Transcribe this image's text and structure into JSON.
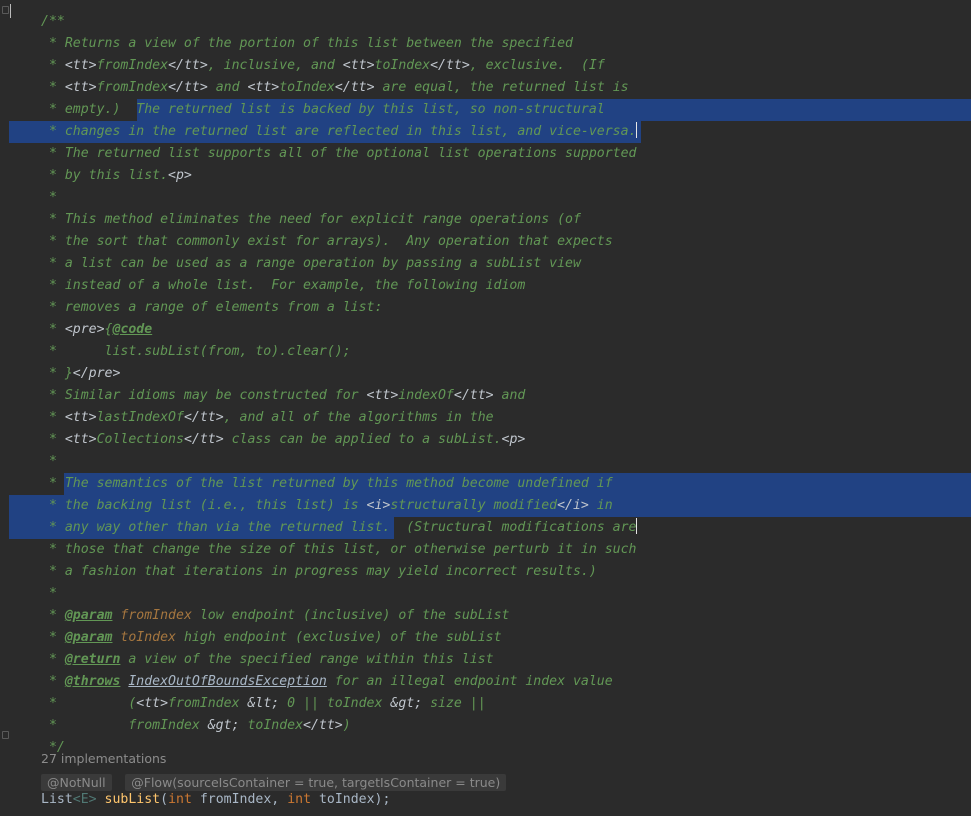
{
  "editor": {
    "doc_lines": [
      "/**",
      " * Returns a view of the portion of this list between the specified",
      " * <tt>fromIndex</tt>, inclusive, and <tt>toIndex</tt>, exclusive.  (If",
      " * <tt>fromIndex</tt> and <tt>toIndex</tt> are equal, the returned list is",
      " * empty.)  The returned list is backed by this list, so non-structural",
      " * changes in the returned list are reflected in this list, and vice-versa.",
      " * The returned list supports all of the optional list operations supported",
      " * by this list.<p>",
      " *",
      " * This method eliminates the need for explicit range operations (of",
      " * the sort that commonly exist for arrays).  Any operation that expects",
      " * a list can be used as a range operation by passing a subList view",
      " * instead of a whole list.  For example, the following idiom",
      " * removes a range of elements from a list:",
      " * <pre>{@code",
      " *      list.subList(from, to).clear();",
      " * }</pre>",
      " * Similar idioms may be constructed for <tt>indexOf</tt> and",
      " * <tt>lastIndexOf</tt>, and all of the algorithms in the",
      " * <tt>Collections</tt> class can be applied to a subList.<p>",
      " *",
      " * The semantics of the list returned by this method become undefined if",
      " * the backing list (i.e., this list) is <i>structurally modified</i> in",
      " * any way other than via the returned list.  (Structural modifications are",
      " * those that change the size of this list, or otherwise perturb it in such",
      " * a fashion that iterations in progress may yield incorrect results.)",
      " *",
      " * @param fromIndex low endpoint (inclusive) of the subList",
      " * @param toIndex high endpoint (exclusive) of the subList",
      " * @return a view of the specified range within this list",
      " * @throws IndexOutOfBoundsException for an illegal endpoint index value",
      " *         (<tt>fromIndex &lt; 0 || toIndex &gt; size ||",
      " *         fromIndex &gt; toIndex</tt>)",
      " */"
    ],
    "implementations_hint": "27 implementations",
    "annotations": [
      "@NotNull",
      "@Flow(sourceIsContainer = true, targetIsContainer = true)"
    ],
    "signature": {
      "return_type": "List",
      "type_param": "<E>",
      "method": "subList",
      "params": "int fromIndex, int toIndex",
      "full": "List<E> subList(int fromIndex, int toIndex);"
    },
    "colors": {
      "background": "#2b2b2b",
      "doc_comment": "#629755",
      "selection": "#214283",
      "keyword": "#cc7832",
      "method": "#ffc66d",
      "param_name": "#a5763f"
    }
  }
}
